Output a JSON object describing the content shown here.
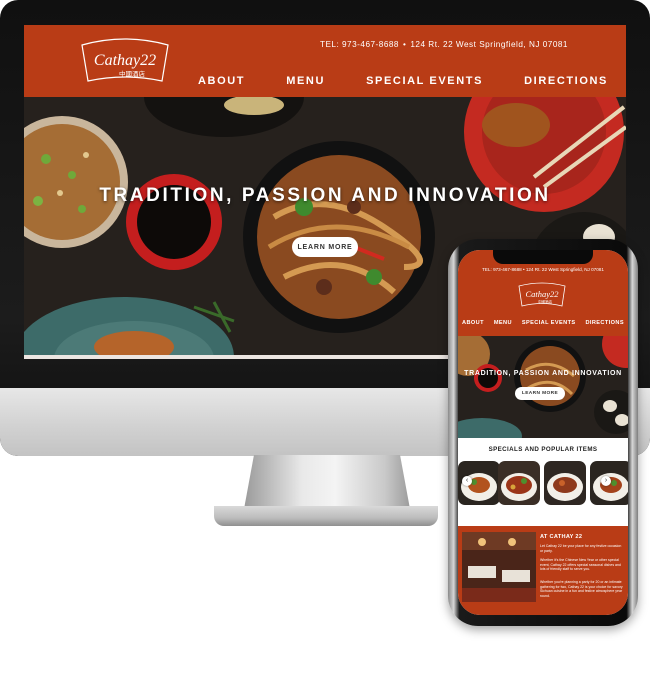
{
  "brand": {
    "logo_text": "Cathay22",
    "logo_chinese": "中國酒店",
    "accent_color": "#b93c16"
  },
  "desktop": {
    "contact": {
      "phone": "TEL: 973-467-8688",
      "separator": "•",
      "address": "124 Rt. 22 West Springfield, NJ 07081"
    },
    "nav": [
      "ABOUT",
      "MENU",
      "SPECIAL EVENTS",
      "DIRECTIONS"
    ],
    "hero": {
      "title": "TRADITION, PASSION AND INNOVATION",
      "button_label": "LEARN MORE"
    }
  },
  "mobile": {
    "contact": "TEL: 973-467-8688 • 124 Rt. 22 West Springfield, NJ 07081",
    "nav": [
      "ABOUT",
      "MENU",
      "SPECIAL EVENTS",
      "DIRECTIONS"
    ],
    "hero": {
      "title": "TRADITION, PASSION AND INNOVATION",
      "button_label": "LEARN MORE"
    },
    "specials": {
      "title": "SPECIALS AND POPULAR ITEMS",
      "prev_icon": "chevron-left-icon",
      "next_icon": "chevron-right-icon"
    },
    "about": {
      "title": "AT CATHAY 22",
      "paragraphs": [
        "Let Cathay 22 be your place for any festive occasion or party.",
        "Whether it's the Chinese New Year or other special event, Cathay 22 offers special seasonal dishes and lots of friendly staff to serve you.",
        "Whether you're planning a party for 20 or an intimate gathering for two, Cathay 22 is your choice for savory Sichuan cuisine in a fun and festive atmosphere year round."
      ]
    }
  }
}
